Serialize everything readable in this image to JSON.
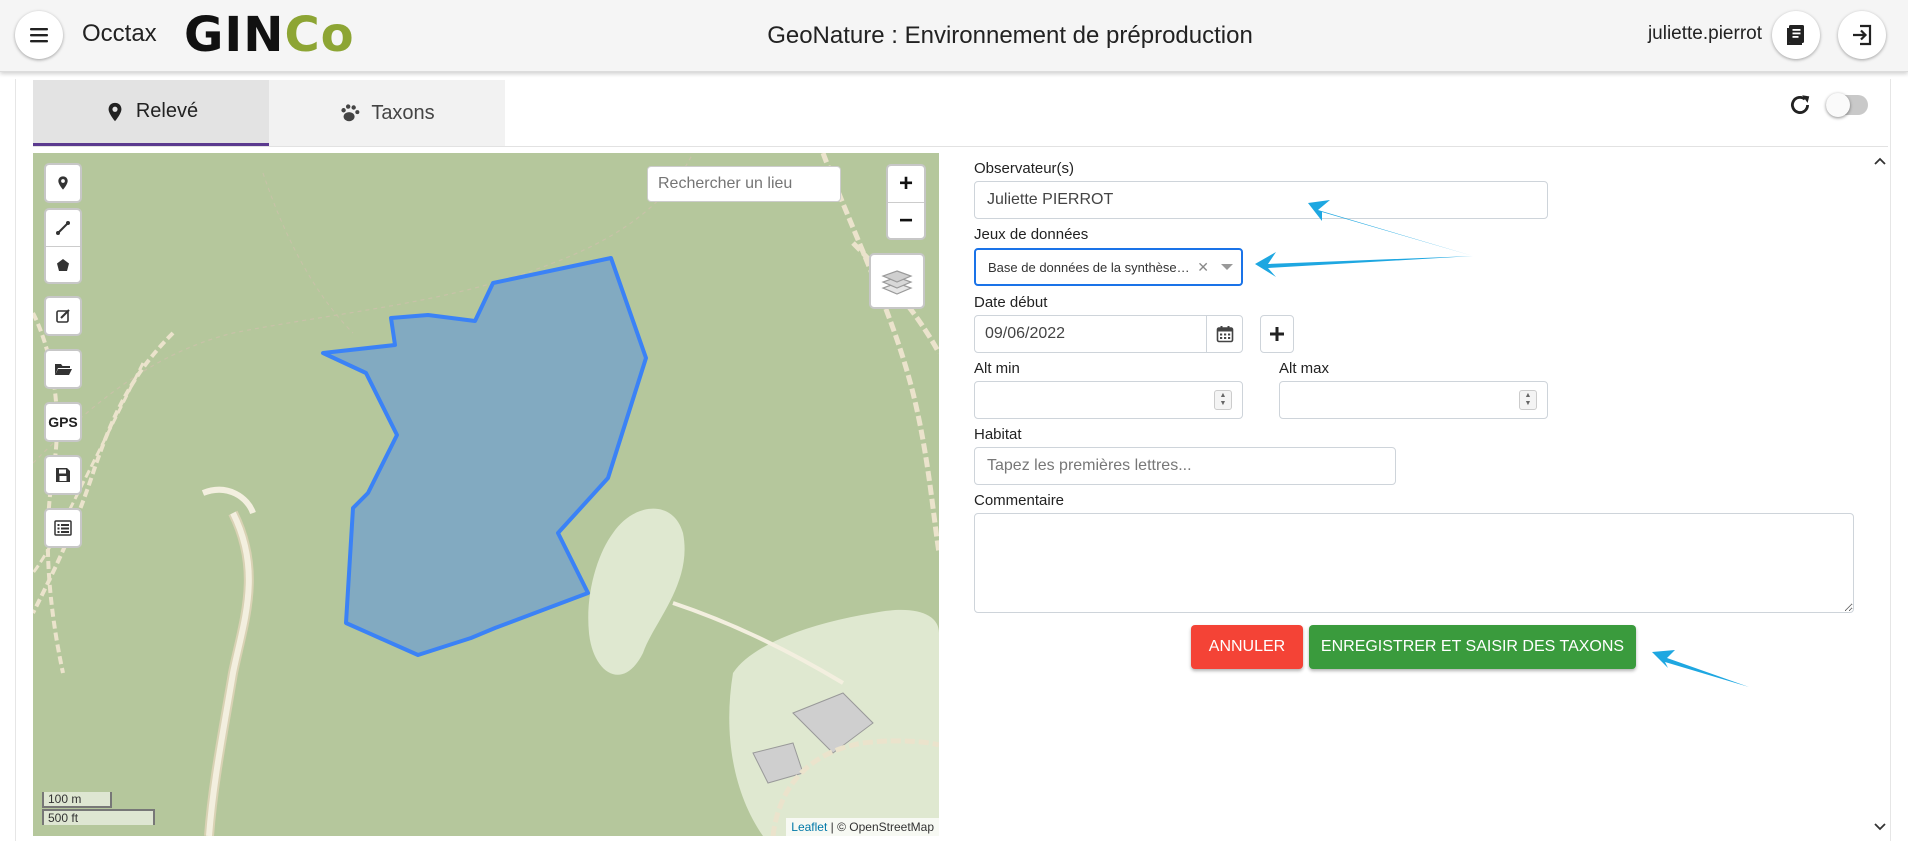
{
  "header": {
    "app_name": "Occtax",
    "logo_text_dark": "GIN",
    "logo_text_green": "Co",
    "title": "GeoNature : Environnement de préproduction",
    "user": "juliette.pierrot"
  },
  "tabs": [
    {
      "label": "Relevé",
      "icon": "map-marker-icon",
      "active": true
    },
    {
      "label": "Taxons",
      "icon": "paw-icon",
      "active": false
    }
  ],
  "map": {
    "search_placeholder": "Rechercher un lieu",
    "zoom_in": "+",
    "zoom_out": "−",
    "gps_label": "GPS",
    "scale_metric": "100 m",
    "scale_imperial": "500 ft",
    "attribution_link": "Leaflet",
    "attribution_text": "| © OpenStreetMap",
    "polygon_color": "#3b82f6"
  },
  "form": {
    "observers_label": "Observateur(s)",
    "observers_value": "Juliette PIERROT",
    "dataset_label": "Jeux de données",
    "dataset_value": "Base de données de la synthèse nationale",
    "date_label": "Date début",
    "date_value": "09/06/2022",
    "alt_min_label": "Alt min",
    "alt_max_label": "Alt max",
    "habitat_label": "Habitat",
    "habitat_placeholder": "Tapez les premières lettres...",
    "comment_label": "Commentaire",
    "cancel_label": "ANNULER",
    "save_label": "ENREGISTRER ET SAISIR DES TAXONS"
  },
  "colors": {
    "accent_arrow": "#1ea7e1",
    "cancel": "#f44336",
    "save": "#3a9b3d",
    "logo_green": "#8da534"
  }
}
